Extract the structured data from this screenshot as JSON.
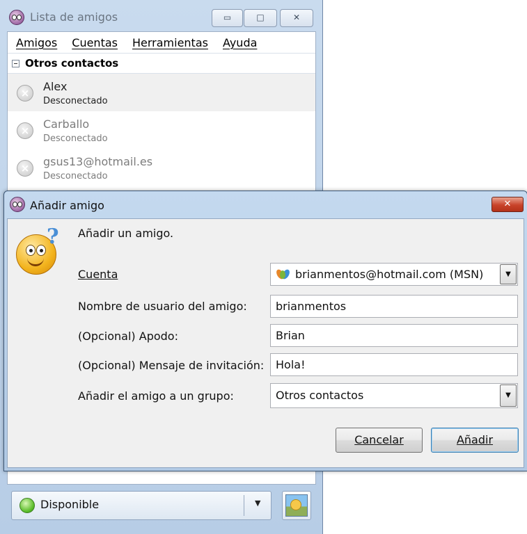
{
  "buddy_window": {
    "title": "Lista de amigos",
    "min_icon": "▭",
    "max_icon": "□",
    "close_icon": "✕",
    "menu": [
      "Amigos",
      "Cuentas",
      "Herramientas",
      "Ayuda"
    ],
    "group_name": "Otros contactos",
    "contacts": [
      {
        "name": "Alex",
        "status": "Desconectado",
        "selected": true
      },
      {
        "name": "Carballo",
        "status": "Desconectado",
        "selected": false
      },
      {
        "name": "gsus13@hotmail.es",
        "status": "Desconectado",
        "selected": false
      }
    ],
    "status_selector": {
      "label": "Disponible",
      "arrow": "▼"
    }
  },
  "dialog": {
    "title": "Añadir amigo",
    "close_icon": "✕",
    "heading": "Añadir un amigo.",
    "fields": {
      "account": {
        "label": "Cuenta",
        "value": "brianmentos@hotmail.com (MSN)"
      },
      "username": {
        "label": "Nombre de usuario del amigo:",
        "value": "brianmentos"
      },
      "alias": {
        "label": "(Opcional) Apodo:",
        "value": "Brian"
      },
      "message": {
        "label": "(Opcional) Mensaje de invitación:",
        "value": "Hola!"
      },
      "group": {
        "label": "Añadir el amigo a un grupo:",
        "value": "Otros contactos"
      }
    },
    "combo_arrow": "▼",
    "buttons": {
      "cancel": "Cancelar",
      "add": "Añadir"
    }
  },
  "colors": {
    "title_bar": "#c4d9ef",
    "close_red": "#c8432a",
    "status_green": "#5bbd2a",
    "default_button_border": "#3c7fb1"
  }
}
